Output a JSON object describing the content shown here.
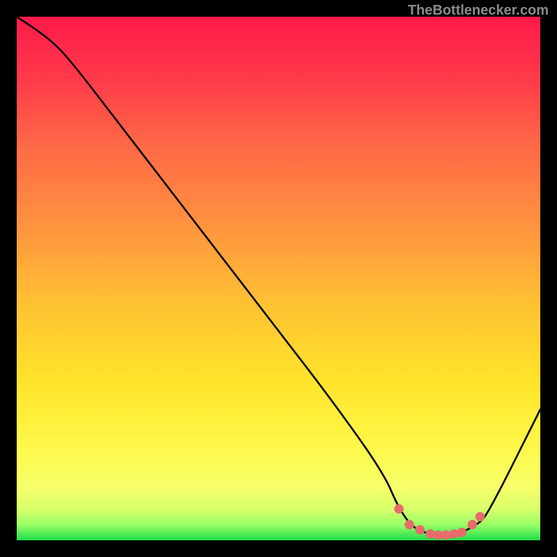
{
  "watermark": "TheBottlenecker.com",
  "chart_data": {
    "type": "line",
    "title": "",
    "xlabel": "",
    "ylabel": "",
    "xlim": [
      0,
      100
    ],
    "ylim": [
      0,
      100
    ],
    "series": [
      {
        "name": "curve",
        "x": [
          0,
          6,
          10,
          20,
          30,
          40,
          50,
          60,
          70,
          73,
          76,
          80,
          84,
          88,
          90,
          100
        ],
        "y": [
          100,
          96,
          92,
          79,
          66,
          53,
          40,
          27,
          13,
          6,
          2,
          1,
          1,
          3,
          5,
          25
        ]
      },
      {
        "name": "highlight-dots",
        "x": [
          73,
          75,
          77,
          79,
          80.5,
          82,
          83.5,
          85,
          87,
          88.5
        ],
        "y": [
          6,
          3,
          2,
          1.2,
          1,
          1,
          1.2,
          1.5,
          3,
          4.5
        ]
      }
    ],
    "gradient_stops": [
      {
        "pos": 0.0,
        "color": "#ff1a4a"
      },
      {
        "pos": 0.12,
        "color": "#ff3a4a"
      },
      {
        "pos": 0.25,
        "color": "#ff6a46"
      },
      {
        "pos": 0.4,
        "color": "#ff933f"
      },
      {
        "pos": 0.55,
        "color": "#ffc232"
      },
      {
        "pos": 0.7,
        "color": "#ffe42a"
      },
      {
        "pos": 0.82,
        "color": "#fff84a"
      },
      {
        "pos": 0.9,
        "color": "#f6ff6a"
      },
      {
        "pos": 0.94,
        "color": "#d8ff6a"
      },
      {
        "pos": 0.97,
        "color": "#9aff66"
      },
      {
        "pos": 1.0,
        "color": "#1fde4a"
      }
    ]
  }
}
